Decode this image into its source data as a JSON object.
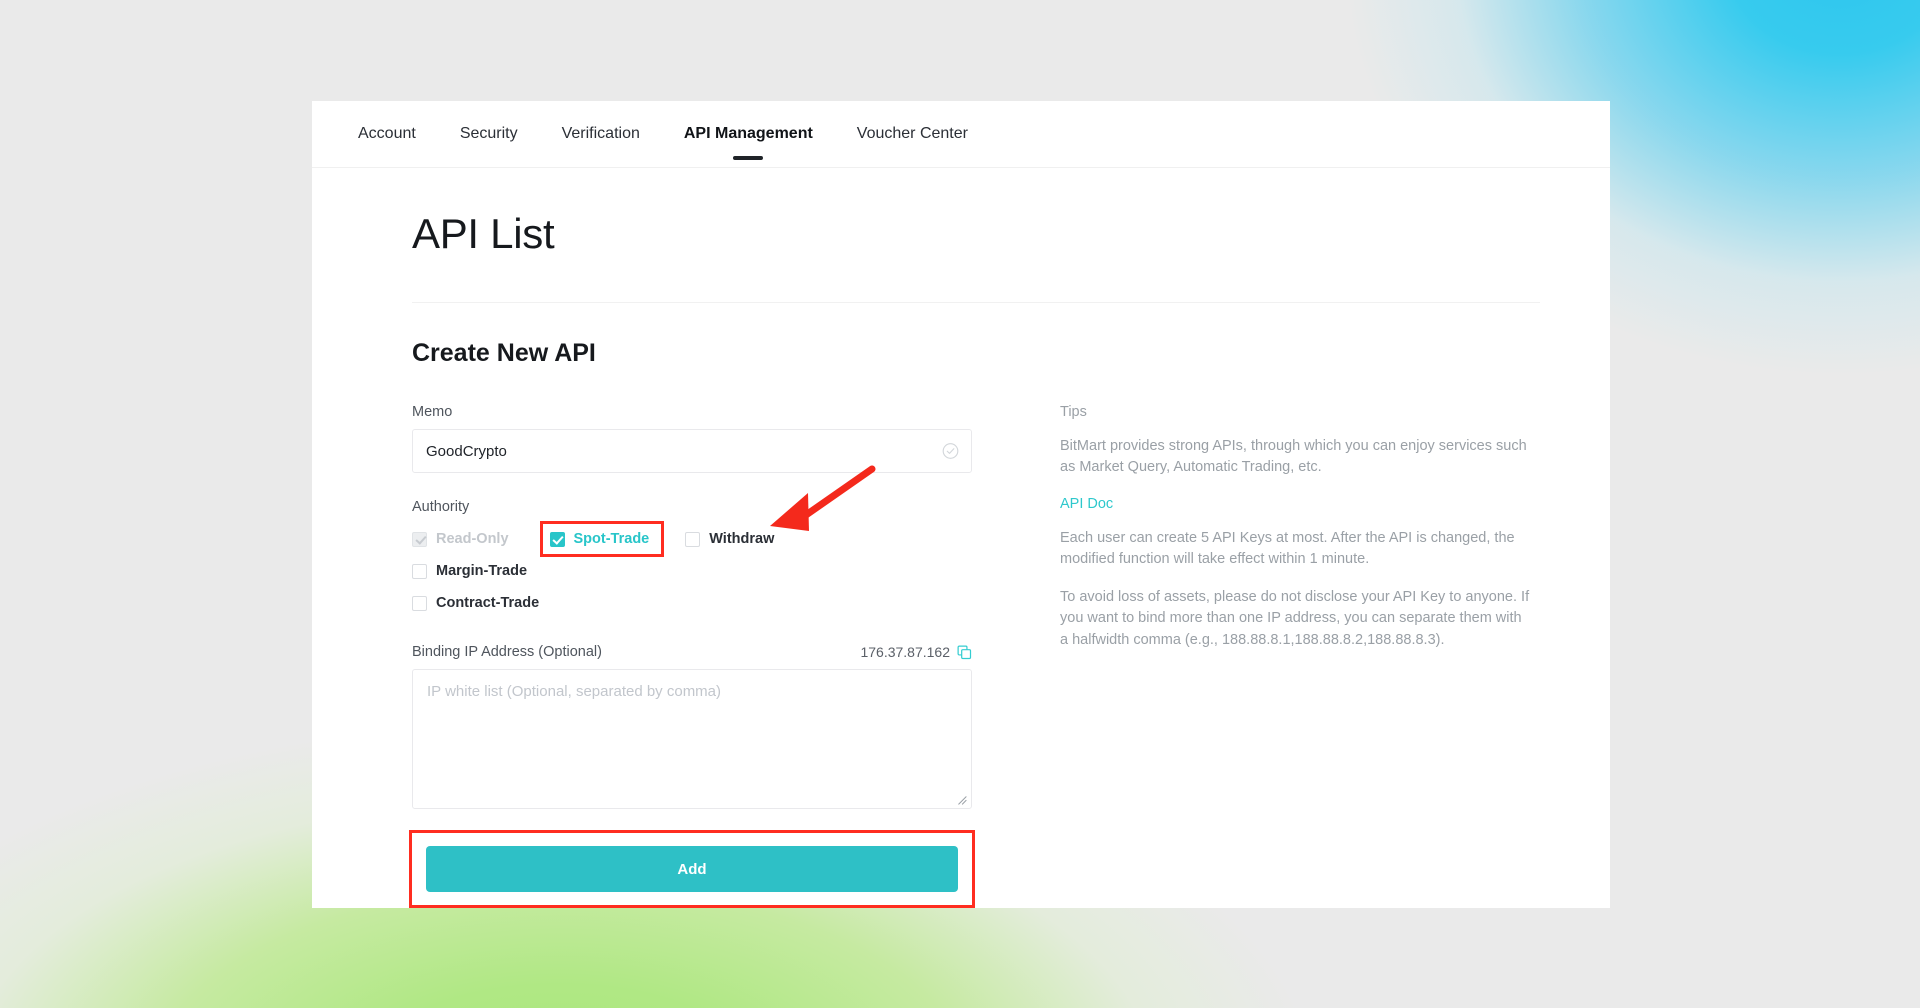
{
  "tabs": [
    {
      "label": "Account",
      "active": false
    },
    {
      "label": "Security",
      "active": false
    },
    {
      "label": "Verification",
      "active": false
    },
    {
      "label": "API Management",
      "active": true
    },
    {
      "label": "Voucher Center",
      "active": false
    }
  ],
  "page": {
    "title": "API List",
    "section_title": "Create New API"
  },
  "form": {
    "memo": {
      "label": "Memo",
      "value": "GoodCrypto",
      "placeholder": "",
      "valid_icon": "check-circle-icon"
    },
    "authority": {
      "label": "Authority",
      "permissions": [
        {
          "label": "Read-Only",
          "checked": true,
          "disabled": true,
          "highlighted": false
        },
        {
          "label": "Spot-Trade",
          "checked": true,
          "disabled": false,
          "highlighted": true
        },
        {
          "label": "Withdraw",
          "checked": false,
          "disabled": false,
          "highlighted": false
        },
        {
          "label": "Margin-Trade",
          "checked": false,
          "disabled": false,
          "highlighted": false
        },
        {
          "label": "Contract-Trade",
          "checked": false,
          "disabled": false,
          "highlighted": false
        }
      ]
    },
    "binding_ip": {
      "label": "Binding IP Address (Optional)",
      "current_ip": "176.37.87.162",
      "copy_icon": "copy-icon",
      "textarea_value": "",
      "textarea_placeholder": "IP white list (Optional, separated by comma)"
    },
    "submit_label": "Add"
  },
  "tips": {
    "heading": "Tips",
    "paragraph_1": "BitMart provides strong APIs, through which you can enjoy services such as Market Query, Automatic Trading, etc.",
    "api_doc_link": "API Doc",
    "paragraph_2": "Each user can create 5 API Keys at most. After the API is changed, the modified function will take effect within 1 minute.",
    "paragraph_3": "To avoid loss of assets, please do not disclose your API Key to anyone. If you want to bind more than one IP address, you can separate them with a halfwidth comma (e.g., 188.88.8.1,188.88.8.2,188.88.8.3)."
  },
  "colors": {
    "accent_teal": "#2ec0c6",
    "checkbox_teal": "#28c5c9",
    "link_teal": "#2ec8cc",
    "annotation_red": "#ff2d20",
    "text_dark": "#16191d",
    "text_muted": "#9aa0a6"
  }
}
